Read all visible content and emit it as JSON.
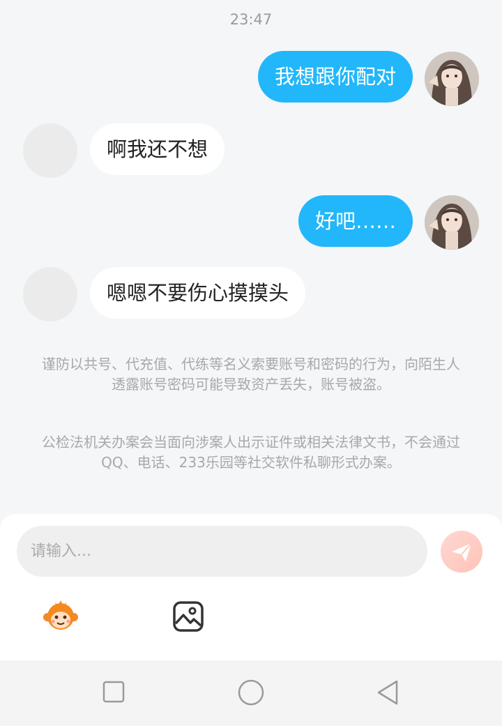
{
  "chat": {
    "timestamp": "23:47",
    "messages": [
      {
        "side": "out",
        "text": "我想跟你配对"
      },
      {
        "side": "in",
        "text": "啊我还不想"
      },
      {
        "side": "out",
        "text": "好吧……"
      },
      {
        "side": "in",
        "text": "嗯嗯不要伤心摸摸头"
      }
    ],
    "notices": [
      "谨防以共号、代充值、代练等名义索要账号和密码的行为，向陌生人透露账号密码可能导致资产丢失，账号被盗。",
      "公检法机关办案会当面向涉案人出示证件或相关法律文书，不会通过QQ、电话、233乐园等社交软件私聊形式办案。"
    ]
  },
  "composer": {
    "placeholder": "请输入...",
    "send_icon": "paper-plane-icon",
    "send_color": "#ffc9bf",
    "tools": [
      "monkey-emoji-icon",
      "image-icon"
    ]
  },
  "colors": {
    "outgoing_bubble": "#22b7fa",
    "incoming_bubble": "#ffffff",
    "background": "#f4f6f8"
  },
  "system_nav": [
    "recent-apps-icon",
    "home-icon",
    "back-icon"
  ]
}
